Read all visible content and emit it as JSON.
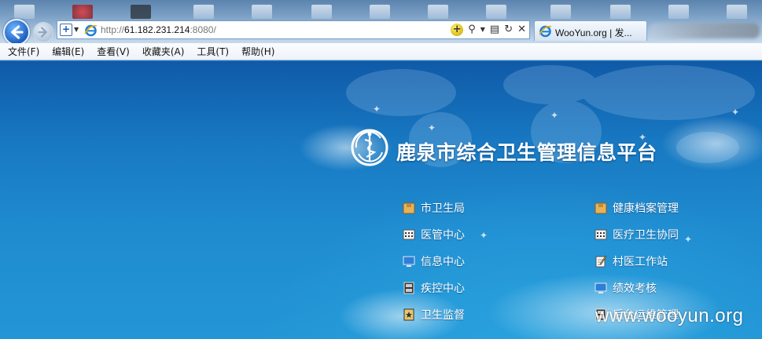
{
  "browser": {
    "url_prefix": "http://",
    "url_host": "61.182.231.214",
    "url_suffix": ":8080/",
    "tab_label": "WooYun.org | 发...",
    "menu": [
      "文件(F)",
      "编辑(E)",
      "查看(V)",
      "收藏夹(A)",
      "工具(T)",
      "帮助(H)"
    ]
  },
  "page": {
    "title": "鹿泉市综合卫生管理信息平台",
    "left_links": [
      {
        "label": "市卫生局",
        "icon": "folder-icon"
      },
      {
        "label": "医管中心",
        "icon": "calendar-grid-icon"
      },
      {
        "label": "信息中心",
        "icon": "monitor-icon"
      },
      {
        "label": "疾控中心",
        "icon": "film-icon"
      },
      {
        "label": "卫生监督",
        "icon": "badge-star-icon"
      }
    ],
    "right_links": [
      {
        "label": "健康档案管理",
        "icon": "folder-icon"
      },
      {
        "label": "医疗卫生协同",
        "icon": "calendar-grid-icon"
      },
      {
        "label": "村医工作站",
        "icon": "notepad-pen-icon"
      },
      {
        "label": "绩效考核",
        "icon": "monitor-icon"
      },
      {
        "label": "后台运维管理",
        "icon": "film-icon"
      }
    ]
  },
  "watermark": "www.wooyun.org"
}
